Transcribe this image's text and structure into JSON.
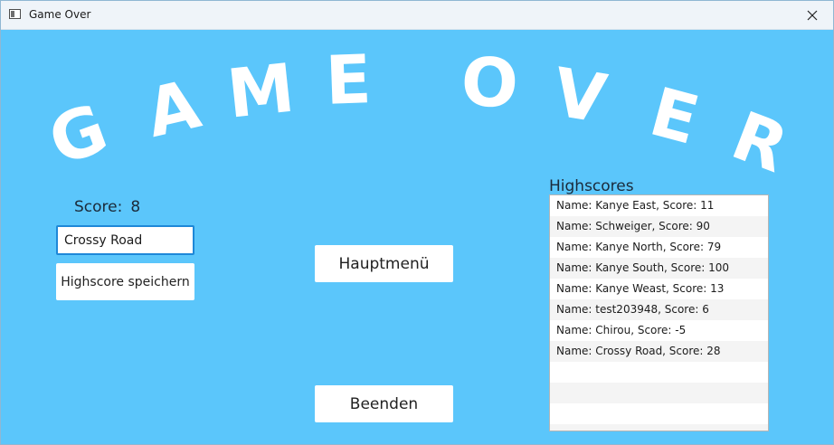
{
  "window": {
    "title": "Game Over",
    "close_icon": "close-icon"
  },
  "banner": {
    "letters": [
      "G",
      "A",
      "M",
      "E",
      "O",
      "V",
      "E",
      "R"
    ]
  },
  "score": {
    "label": "Score:",
    "value": "8"
  },
  "name_input": {
    "value": "Crossy Road"
  },
  "buttons": {
    "save": "Highscore speichern",
    "menu": "Hauptmenü",
    "quit": "Beenden"
  },
  "highscores": {
    "title": "Highscores",
    "entries": [
      "Name: Kanye East, Score: 11",
      "Name: Schweiger, Score: 90",
      "Name: Kanye North, Score: 79",
      "Name: Kanye South, Score: 100",
      "Name: Kanye Weast, Score: 13",
      "Name: test203948, Score: 6",
      "Name: Chirou, Score: -5",
      "Name: Crossy Road, Score: 28",
      "",
      "",
      "",
      ""
    ]
  },
  "colors": {
    "background": "#5bc6fb",
    "banner_text": "#ffffff",
    "focus_border": "#1e88d8"
  }
}
